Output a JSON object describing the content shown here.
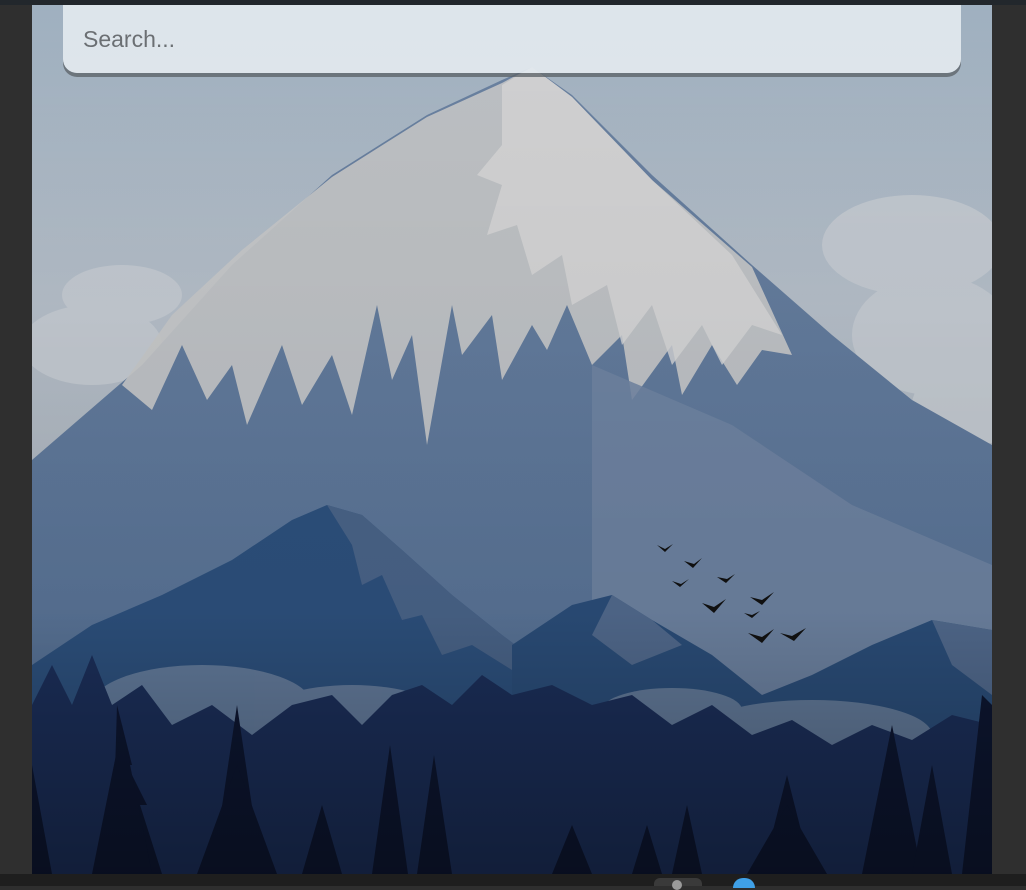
{
  "search": {
    "placeholder": "Search...",
    "value": ""
  },
  "wallpaper": {
    "description_icon": "mountain-landscape",
    "colors": {
      "sky_top": "#9aacbd",
      "sky_bottom": "#c5ccd4",
      "snow": "#c6c7c9",
      "far_mountain": "#5d7594",
      "mid_mountain": "#2f527c",
      "forest": "#1a2d55",
      "foreground_trees": "#0c1429"
    }
  },
  "taskbar": {
    "icons": [
      "app-icon",
      "browser-icon"
    ]
  }
}
